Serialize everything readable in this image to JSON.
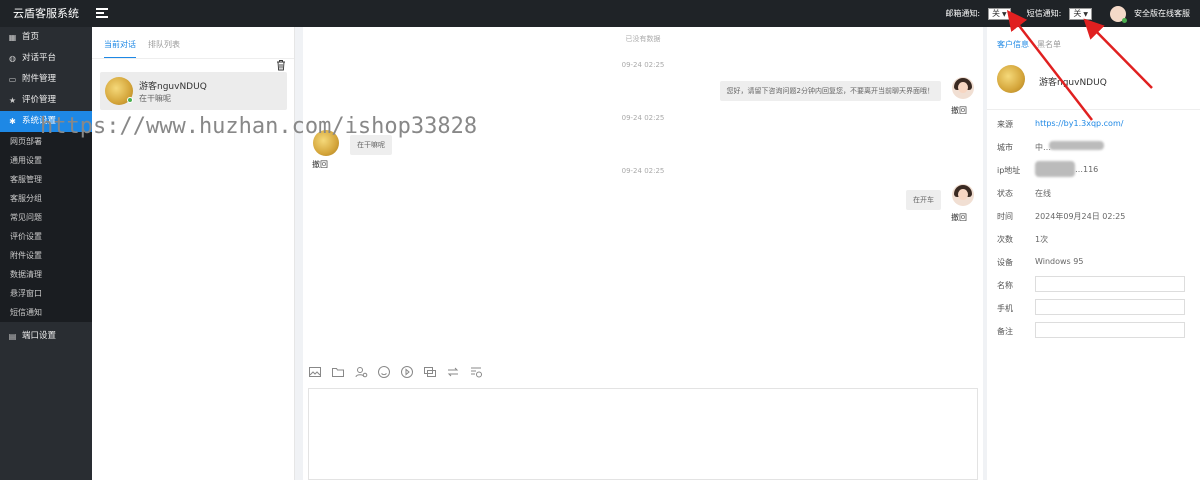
{
  "app": {
    "title": "云盾客服系统"
  },
  "topbar": {
    "email_label": "邮箱通知:",
    "email_value": "关",
    "sms_label": "短信通知:",
    "sms_value": "关",
    "agent_name": "安全版在线客服"
  },
  "sidebar": {
    "items": [
      {
        "label": "首页",
        "icon": "dashboard-icon"
      },
      {
        "label": "对话平台",
        "icon": "chat-icon"
      },
      {
        "label": "附件管理",
        "icon": "folder-icon"
      },
      {
        "label": "评价管理",
        "icon": "star-icon"
      },
      {
        "label": "系统设置",
        "icon": "gear-icon"
      }
    ],
    "sub_items": [
      "网页部署",
      "通用设置",
      "客服管理",
      "客服分组",
      "常见问题",
      "评价设置",
      "附件设置",
      "数据清理",
      "悬浮窗口",
      "短信通知"
    ],
    "bottom_item": {
      "label": "端口设置",
      "icon": "port-icon"
    }
  },
  "conversations": {
    "tabs": [
      "当前对话",
      "排队列表"
    ],
    "items": [
      {
        "name": "游客nguvNDUQ",
        "last_message": "在干嘛呢"
      }
    ]
  },
  "chat": {
    "top_notice": "已没有数据",
    "messages": [
      {
        "time": "09-24 02:25",
        "side": "agent",
        "text": "您好，请留下咨询问题2分钟内回复您，不要离开当前聊天界面哦！",
        "action": "撤回"
      },
      {
        "time": "09-24 02:25",
        "side": "visitor",
        "text": "在干嘛呢",
        "action": "撤回"
      },
      {
        "time": "09-24 02:25",
        "side": "agent",
        "text": "在开车",
        "action": "撤回"
      }
    ],
    "tools": [
      "image-icon",
      "folder-icon",
      "person-icon",
      "emoji-icon",
      "voice-icon",
      "quick-reply-icon",
      "transfer-icon",
      "history-icon"
    ]
  },
  "info": {
    "tabs": [
      "客户信息",
      "黑名单"
    ],
    "name": "游客nguvNDUQ",
    "rows": [
      {
        "label": "来源",
        "value": "https://by1.3xqp.com/"
      },
      {
        "label": "城市",
        "value": "中…"
      },
      {
        "label": "ip地址",
        "value": "…116"
      },
      {
        "label": "状态",
        "value": "在线"
      },
      {
        "label": "时间",
        "value": "2024年09月24日 02:25"
      },
      {
        "label": "次数",
        "value": "1次"
      },
      {
        "label": "设备",
        "value": "Windows 95"
      }
    ],
    "fields": [
      {
        "label": "名称",
        "value": ""
      },
      {
        "label": "手机",
        "value": ""
      },
      {
        "label": "备注",
        "value": ""
      }
    ]
  },
  "watermark": "https://www.huzhan.com/ishop33828",
  "colors": {
    "accent": "#1e88e5",
    "sidebar": "#292d32",
    "topbar": "#1f2327",
    "online": "#4caf50",
    "annotation": "#e02020"
  }
}
